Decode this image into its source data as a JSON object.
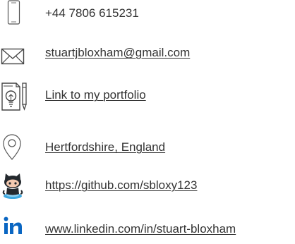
{
  "contacts": [
    {
      "id": "phone",
      "icon": "phone-icon",
      "text": "+44 7806 615231",
      "is_link": false
    },
    {
      "id": "email",
      "icon": "envelope-icon",
      "text": "stuartjbloxham@gmail.com",
      "is_link": true
    },
    {
      "id": "portfolio",
      "icon": "portfolio-lightbulb-icon",
      "text": "Link to my portfolio",
      "is_link": true
    },
    {
      "id": "location",
      "icon": "map-pin-icon",
      "text": "Hertfordshire, England",
      "is_link": true
    },
    {
      "id": "github",
      "icon": "github-octocat-icon",
      "text": "https://github.com/sbloxy123",
      "is_link": true
    },
    {
      "id": "linkedin",
      "icon": "linkedin-icon",
      "text": "www.linkedin.com/in/stuart-bloxham",
      "is_link": true
    }
  ],
  "colors": {
    "text": "#333333",
    "icon_stroke": "#444444",
    "linkedin_blue": "#0a66c2",
    "octocat_dark": "#24292e",
    "octocat_water": "#3ea8e0"
  }
}
